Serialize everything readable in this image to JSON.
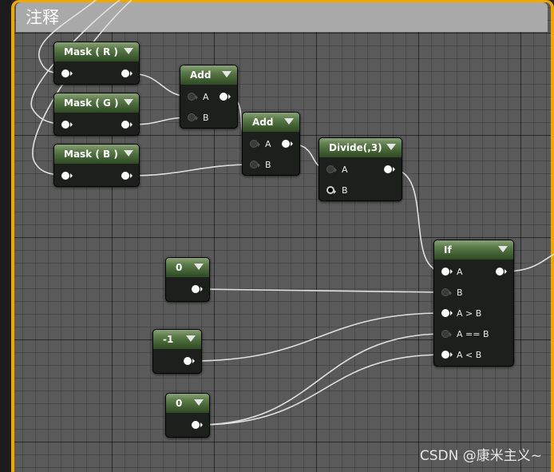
{
  "comment": {
    "title": "注释"
  },
  "nodes": {
    "mask_r": {
      "title": "Mask ( R )"
    },
    "mask_g": {
      "title": "Mask ( G )"
    },
    "mask_b": {
      "title": "Mask ( B )"
    },
    "add1": {
      "title": "Add",
      "pin_a": "A",
      "pin_b": "B"
    },
    "add2": {
      "title": "Add",
      "pin_a": "A",
      "pin_b": "B"
    },
    "divide": {
      "title": "Divide(,3)",
      "pin_a": "A",
      "pin_b": "B"
    },
    "const_0_top": {
      "title": "0"
    },
    "const_neg1": {
      "title": "-1"
    },
    "const_0_bottom": {
      "title": "0"
    },
    "if_node": {
      "title": "If",
      "pins": [
        "A",
        "B",
        "A > B",
        "A == B",
        "A < B"
      ]
    }
  },
  "colors": {
    "comment_border": "#f0a800",
    "node_header": "#5a7a48",
    "wire": "#e0e0e0"
  },
  "watermark": "CSDN @康米主义~"
}
